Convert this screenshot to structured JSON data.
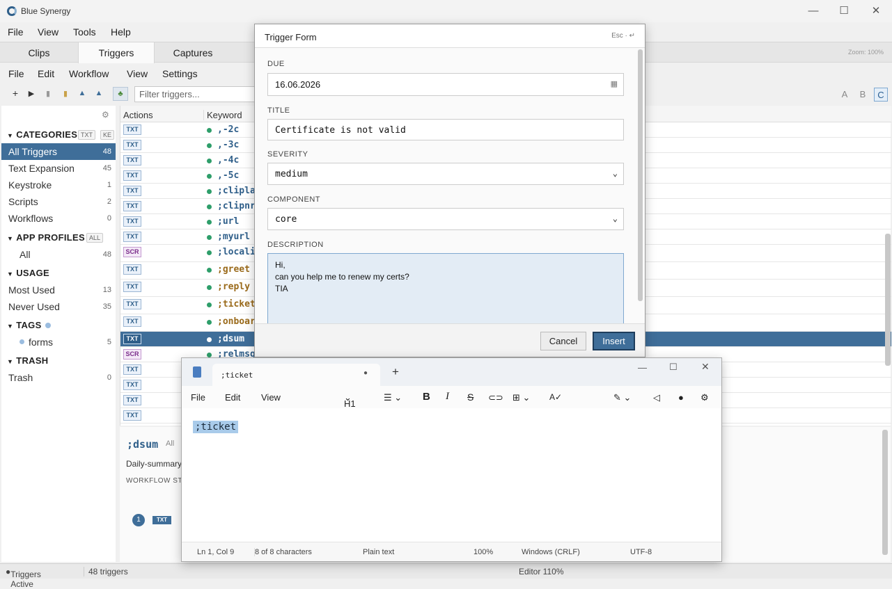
{
  "app": {
    "title": "Blue Synergy",
    "zoom": "Zoom: 100%"
  },
  "menubar": [
    "File",
    "View",
    "Tools",
    "Help"
  ],
  "tabs": [
    "Clips",
    "Triggers",
    "Captures"
  ],
  "menu2": [
    "File",
    "Edit",
    "Workflow",
    "View",
    "Settings"
  ],
  "toolbar": {
    "filter_placeholder": "Filter triggers...",
    "letters": [
      "A",
      "B",
      "C"
    ]
  },
  "sidebar": {
    "categories": {
      "title": "CATEGORIES",
      "badges": [
        "TXT",
        "KE"
      ]
    },
    "category_items": [
      {
        "label": "All Triggers",
        "count": "48"
      },
      {
        "label": "Text Expansion",
        "count": "45"
      },
      {
        "label": "Keystroke",
        "count": "1"
      },
      {
        "label": "Scripts",
        "count": "2"
      },
      {
        "label": "Workflows",
        "count": "0"
      }
    ],
    "app_profiles": {
      "title": "APP PROFILES",
      "badge": "ALL",
      "items": [
        {
          "label": "All",
          "count": "48"
        }
      ]
    },
    "usage": {
      "title": "USAGE",
      "items": [
        {
          "label": "Most Used",
          "count": "13"
        },
        {
          "label": "Never Used",
          "count": "35"
        }
      ]
    },
    "tags": {
      "title": "TAGS",
      "items": [
        {
          "label": "forms",
          "count": "5"
        }
      ]
    },
    "trash": {
      "title": "TRASH",
      "items": [
        {
          "label": "Trash",
          "count": "0"
        }
      ]
    }
  },
  "table": {
    "headers": [
      "Actions",
      "Keyword"
    ],
    "rows": [
      {
        "tag": "TXT",
        "kw": ",-2c"
      },
      {
        "tag": "TXT",
        "kw": ",-3c"
      },
      {
        "tag": "TXT",
        "kw": ",-4c"
      },
      {
        "tag": "TXT",
        "kw": ",-5c"
      },
      {
        "tag": "TXT",
        "kw": ";clipla"
      },
      {
        "tag": "TXT",
        "kw": ";clipnr"
      },
      {
        "tag": "TXT",
        "kw": ";url"
      },
      {
        "tag": "TXT",
        "kw": ";myurl"
      },
      {
        "tag": "SCR",
        "kw": ";localip"
      },
      {
        "tag": "TXT",
        "kw": ";greet"
      },
      {
        "tag": "TXT",
        "kw": ";reply"
      },
      {
        "tag": "TXT",
        "kw": ";ticket"
      },
      {
        "tag": "TXT",
        "kw": ";onboard"
      },
      {
        "tag": "TXT",
        "kw": ";dsum"
      },
      {
        "tag": "SCR",
        "kw": ";relmsg"
      },
      {
        "tag": "TXT",
        "kw": ""
      },
      {
        "tag": "TXT",
        "kw": ""
      },
      {
        "tag": "TXT",
        "kw": ""
      },
      {
        "tag": "TXT",
        "kw": ""
      }
    ]
  },
  "details": {
    "keyword": ";dsum",
    "scope": "All",
    "desc": "Daily-summary",
    "section": "WORKFLOW ST",
    "step_num": "1",
    "step_tag": "TXT"
  },
  "statusbar": {
    "active": "Triggers Active",
    "count": "48 triggers",
    "editor": "Editor 110%"
  },
  "modal": {
    "title": "Trigger Form",
    "hint": "Esc · ↵",
    "due_label": "DUE",
    "due": "16.06.2026",
    "title_label": "TITLE",
    "title_value": "Certificate is not valid",
    "severity_label": "SEVERITY",
    "severity": "medium",
    "component_label": "COMPONENT",
    "component": "core",
    "description_label": "DESCRIPTION",
    "description_lines": [
      "Hi,",
      "can you help me to renew my certs?",
      "TIA"
    ],
    "cancel": "Cancel",
    "insert": "Insert"
  },
  "notepad": {
    "tab": ";ticket",
    "menu": [
      "File",
      "Edit",
      "View"
    ],
    "heading": "H1",
    "content": ";ticket",
    "status": [
      "Ln 1, Col 9",
      "8 of 8 characters",
      "Plain text",
      "100%",
      "Windows (CRLF)",
      "UTF-8"
    ]
  }
}
